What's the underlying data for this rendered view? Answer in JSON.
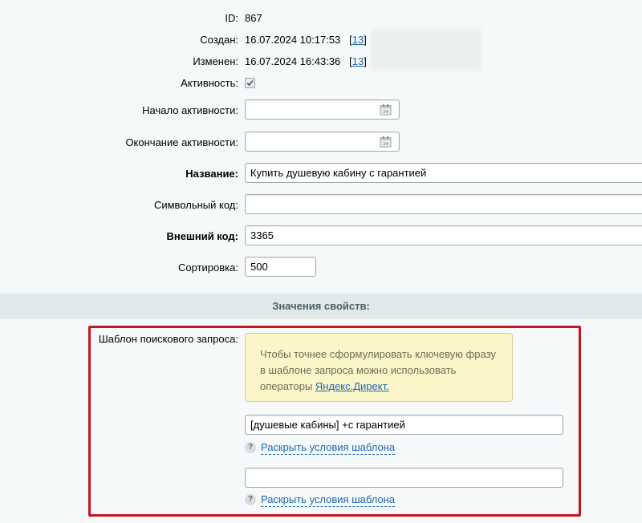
{
  "fields": {
    "id": {
      "label": "ID:",
      "value": "867"
    },
    "created": {
      "label": "Создан:",
      "value": "16.07.2024 10:17:53",
      "user_link": "13"
    },
    "modified": {
      "label": "Изменен:",
      "value": "16.07.2024 16:43:36",
      "user_link": "13"
    },
    "active": {
      "label": "Активность:",
      "checked": true
    },
    "active_from": {
      "label": "Начало активности:",
      "value": ""
    },
    "active_to": {
      "label": "Окончание активности:",
      "value": ""
    },
    "name": {
      "label": "Название:",
      "value": "Купить душевую кабину с гарантией"
    },
    "code": {
      "label": "Символьный код:",
      "value": ""
    },
    "xml_id": {
      "label": "Внешний код:",
      "value": "3365"
    },
    "sort": {
      "label": "Сортировка:",
      "value": "500"
    }
  },
  "section": {
    "title": "Значения свойств:"
  },
  "search_template": {
    "label": "Шаблон поискового запроса:",
    "hint_text": "Чтобы точнее сформулировать ключевую фразу в шаблоне запроса можно использовать операторы ",
    "hint_link": "Яндекс.Директ.",
    "input1": "[душевые кабины] +с гарантией",
    "input2": "",
    "help_icon": "?",
    "expand_label": "Раскрыть условия шаблона"
  },
  "colors": {
    "accent_link": "#2067b0",
    "highlight_border": "#c9141f",
    "hint_bg": "#fbf6c8"
  }
}
